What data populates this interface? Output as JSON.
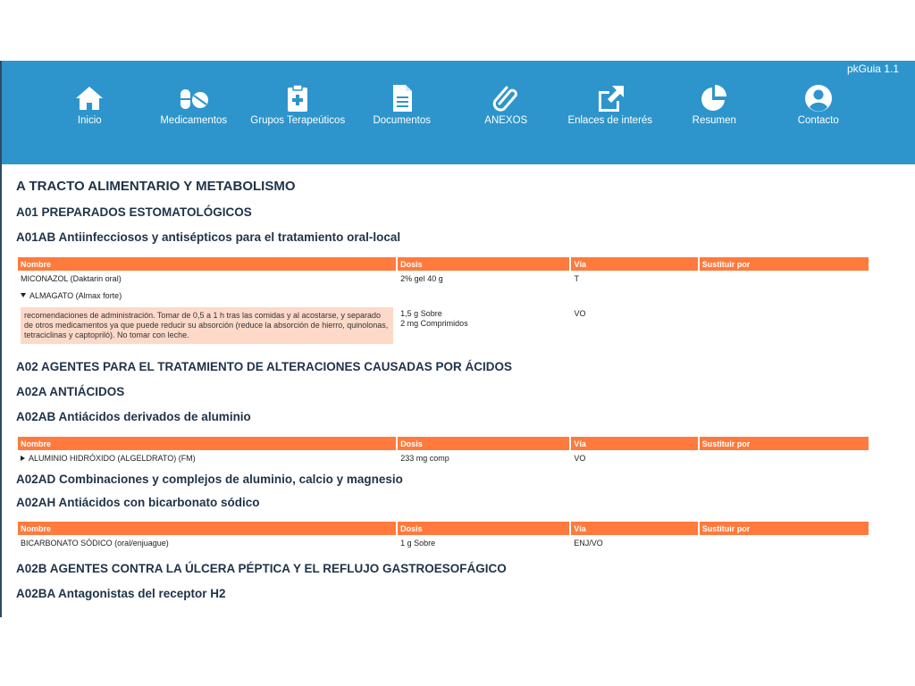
{
  "app": {
    "version": "pkGuia 1.1"
  },
  "nav": {
    "items": [
      {
        "label": "Inicio",
        "icon": "home-icon"
      },
      {
        "label": "Medicamentos",
        "icon": "pills-icon"
      },
      {
        "label": "Grupos Terapeúticos",
        "icon": "clipboard-medical-icon"
      },
      {
        "label": "Documentos",
        "icon": "document-icon"
      },
      {
        "label": "ANEXOS",
        "icon": "paperclip-icon"
      },
      {
        "label": "Enlaces de interés",
        "icon": "external-link-icon"
      },
      {
        "label": "Resumen",
        "icon": "pie-chart-icon"
      },
      {
        "label": "Contacto",
        "icon": "user-circle-icon"
      }
    ]
  },
  "colors": {
    "header": "#2e95cc",
    "table_header": "#ff7a3c",
    "note_bg": "#fdd9c9",
    "heading": "#1f3347"
  },
  "table_headers": {
    "nombre": "Nombre",
    "dosis": "Dosis",
    "via": "Vía",
    "sustituir": "Sustituir por"
  },
  "sections": {
    "a": "A TRACTO ALIMENTARIO Y METABOLISMO",
    "a01": "A01 PREPARADOS ESTOMATOLÓGICOS",
    "a01ab": "A01AB Antiinfecciosos y antisépticos para el tratamiento oral-local",
    "a02": "A02 AGENTES PARA EL TRATAMIENTO DE ALTERACIONES CAUSADAS POR ÁCIDOS",
    "a02a": "A02A ANTIÁCIDOS",
    "a02ab": "A02AB Antiácidos derivados de aluminio",
    "a02ad": "A02AD Combinaciones y complejos de aluminio, calcio y magnesio",
    "a02ah": "A02AH Antiácidos con bicarbonato sódico",
    "a02b": "A02B AGENTES CONTRA LA ÚLCERA PÉPTICA Y EL REFLUJO GASTROESOFÁGICO",
    "a02ba": "A02BA Antagonistas del receptor H2"
  },
  "tables": {
    "a01ab": {
      "miconazol": {
        "nombre": "MICONAZOL (Daktarin oral)",
        "dosis": "2% gel 40 g",
        "via": "T",
        "sustituir": ""
      },
      "almagato": {
        "nombre": "ALMAGATO (Almax forte)",
        "note": "recomendaciones de administración. Tomar de 0,5 a 1 h tras las comidas y al acostarse, y separado de otros medicamentos ya que puede reducir su absorción (reduce la absorción de hierro, quinolonas, tetraciclinas y captopriló). No tomar con leche.",
        "dosis_1": "1,5 g Sobre",
        "dosis_2": "2 mg Comprimidos",
        "via": "VO",
        "sustituir": ""
      }
    },
    "a02ab": {
      "aluminio": {
        "nombre": "ALUMINIO HIDRÓXIDO (ALGELDRATO) (FM)",
        "dosis": "233 mg comp",
        "via": "VO",
        "sustituir": ""
      }
    },
    "a02ah": {
      "bicarbonato": {
        "nombre": "BICARBONATO SÓDICO (oral/enjuague)",
        "dosis": "1 g Sobre",
        "via": "ENJ/VO",
        "sustituir": ""
      }
    }
  }
}
